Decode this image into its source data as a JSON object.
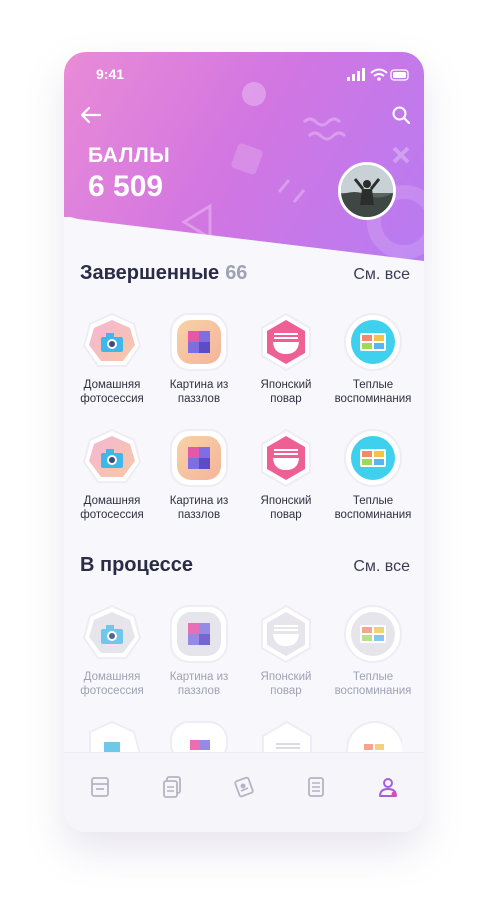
{
  "status_bar": {
    "time": "9:41"
  },
  "header": {
    "points_label": "БАЛЛЫ",
    "points_value": "6 509"
  },
  "completed": {
    "title": "Завершенные",
    "count": "66",
    "see_all": "См. все",
    "rows": [
      [
        {
          "icon": "camera-icon",
          "label_1": "Домашняя",
          "label_2": "фотосессия"
        },
        {
          "icon": "puzzle-icon",
          "label_1": "Картина из",
          "label_2": "паззлов"
        },
        {
          "icon": "noodle-bowl-icon",
          "label_1": "Японский",
          "label_2": "повар"
        },
        {
          "icon": "photo-album-icon",
          "label_1": "Теплые",
          "label_2": "воспоминания"
        }
      ],
      [
        {
          "icon": "camera-icon",
          "label_1": "Домашняя",
          "label_2": "фотосессия"
        },
        {
          "icon": "puzzle-icon",
          "label_1": "Картина из",
          "label_2": "паззлов"
        },
        {
          "icon": "noodle-bowl-icon",
          "label_1": "Японский",
          "label_2": "повар"
        },
        {
          "icon": "photo-album-icon",
          "label_1": "Теплые",
          "label_2": "воспоминания"
        }
      ]
    ]
  },
  "in_progress": {
    "title": "В процессе",
    "see_all": "См. все",
    "rows": [
      [
        {
          "icon": "camera-icon",
          "label_1": "Домашняя",
          "label_2": "фотосессия"
        },
        {
          "icon": "puzzle-icon",
          "label_1": "Картина из",
          "label_2": "паззлов"
        },
        {
          "icon": "noodle-bowl-icon",
          "label_1": "Японский",
          "label_2": "повар"
        },
        {
          "icon": "photo-album-icon",
          "label_1": "Теплые",
          "label_2": "воспоминания"
        }
      ]
    ]
  },
  "bottom_nav": [
    "wallet-icon",
    "documents-icon",
    "cards-icon",
    "list-icon",
    "profile-icon"
  ],
  "colors": {
    "accent": "#a15de6",
    "header_start": "#e98bd6",
    "header_end": "#b47cf3",
    "text_dark": "#2a2c45",
    "text_muted": "#9ea2b5"
  }
}
